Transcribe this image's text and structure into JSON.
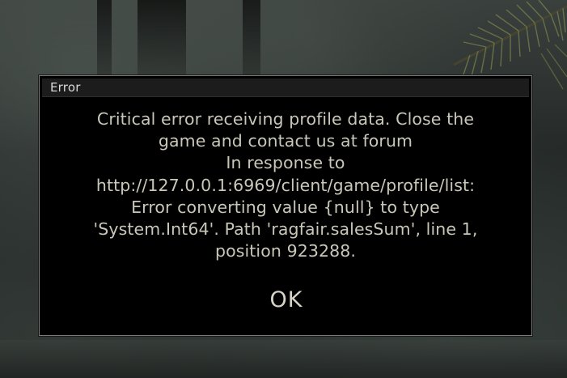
{
  "dialog": {
    "title": "Error",
    "message_lines": [
      "Critical error receiving profile data. Close the",
      "game and contact us at forum",
      "In response to",
      "http://127.0.0.1:6969/client/game/profile/list:",
      "Error converting value {null} to type",
      "'System.Int64'. Path 'ragfair.salesSum', line 1,",
      "position 923288."
    ],
    "ok_label": "OK"
  },
  "colors": {
    "dialog_background": "#000000",
    "dialog_border": "#7a7a7a",
    "titlebar_background": "#1c1c1c",
    "message_text": "#c9c7b8",
    "title_text": "#d9d9d9"
  },
  "icons": {
    "background_decoration": "pine-branch-icon"
  }
}
